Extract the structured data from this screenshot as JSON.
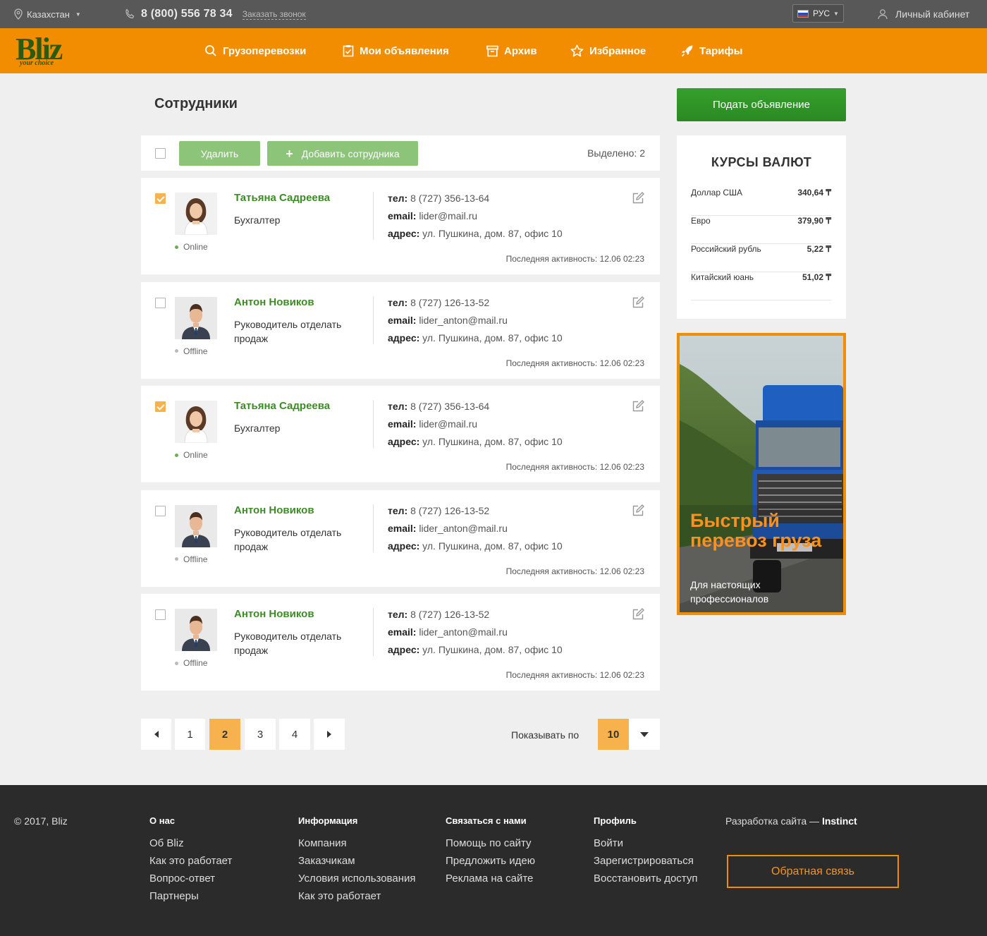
{
  "topbar": {
    "region": "Казахстан",
    "phone": "8 (800) 556 78 34",
    "callback": "Заказать звонок",
    "lang": "РУС",
    "cabinet": "Личный кабинет"
  },
  "logo": {
    "main": "Bliz",
    "sub": "your choice"
  },
  "nav": [
    {
      "label": "Грузоперевозки",
      "icon": "search-icon"
    },
    {
      "label": "Мои объявления",
      "icon": "clipboard-check-icon"
    },
    {
      "label": "Архив",
      "icon": "archive-box-icon"
    },
    {
      "label": "Избранное",
      "icon": "star-icon"
    },
    {
      "label": "Тарифы",
      "icon": "rocket-icon"
    }
  ],
  "page": {
    "title": "Сотрудники"
  },
  "toolbar": {
    "delete": "Удалить",
    "add": "Добавить сотрудника",
    "selected": "Выделено: 2"
  },
  "employees": [
    {
      "name": "Татьяна Садреева",
      "role": "Бухгалтер",
      "status": "Online",
      "checked": true,
      "gender": "female",
      "tel_label": "тел:",
      "tel": "8 (727) 356-13-64",
      "email_label": "email:",
      "email": "lider@mail.ru",
      "addr_label": "адрес:",
      "addr": "ул. Пушкина, дом. 87, офис 10",
      "activity": "Последняя активность: 12.06  02:23"
    },
    {
      "name": "Антон Новиков",
      "role": "Руководитель отделать продаж",
      "status": "Offline",
      "checked": false,
      "gender": "male",
      "tel_label": "тел:",
      "tel": "8 (727) 126-13-52",
      "email_label": "email:",
      "email": "lider_anton@mail.ru",
      "addr_label": "адрес:",
      "addr": "ул. Пушкина, дом. 87, офис 10",
      "activity": "Последняя активность: 12.06  02:23"
    },
    {
      "name": "Татьяна Садреева",
      "role": "Бухгалтер",
      "status": "Online",
      "checked": true,
      "gender": "female",
      "tel_label": "тел:",
      "tel": "8 (727) 356-13-64",
      "email_label": "email:",
      "email": "lider@mail.ru",
      "addr_label": "адрес:",
      "addr": "ул. Пушкина, дом. 87, офис 10",
      "activity": "Последняя активность: 12.06  02:23"
    },
    {
      "name": "Антон Новиков",
      "role": "Руководитель отделать продаж",
      "status": "Offline",
      "checked": false,
      "gender": "male",
      "tel_label": "тел:",
      "tel": "8 (727) 126-13-52",
      "email_label": "email:",
      "email": "lider_anton@mail.ru",
      "addr_label": "адрес:",
      "addr": "ул. Пушкина, дом. 87, офис 10",
      "activity": "Последняя активность: 12.06  02:23"
    },
    {
      "name": "Антон Новиков",
      "role": "Руководитель отделать продаж",
      "status": "Offline",
      "checked": false,
      "gender": "male",
      "tel_label": "тел:",
      "tel": "8 (727) 126-13-52",
      "email_label": "email:",
      "email": "lider_anton@mail.ru",
      "addr_label": "адрес:",
      "addr": "ул. Пушкина, дом. 87, офис 10",
      "activity": "Последняя активность: 12.06  02:23"
    }
  ],
  "pagination": {
    "pages": [
      "1",
      "2",
      "3",
      "4"
    ],
    "current": "2",
    "show_label": "Показывать по",
    "per_page": "10"
  },
  "sidebar": {
    "submit": "Подать объявление",
    "rates_title": "КУРСЫ ВАЛЮТ",
    "rates": [
      {
        "name": "Доллар США",
        "value": "340,64 ₸"
      },
      {
        "name": "Евро",
        "value": "379,90 ₸"
      },
      {
        "name": "Российский рубль",
        "value": "5,22 ₸"
      },
      {
        "name": "Китайский юань",
        "value": "51,02 ₸"
      }
    ],
    "ad_title": "Быстрый перевоз груза",
    "ad_sub": "Для настоящих профессионалов"
  },
  "footer": {
    "copy": "© 2017, Bliz",
    "cols": [
      {
        "head": "О нас",
        "links": [
          "Об Bliz",
          "Как это работает",
          "Вопрос-ответ",
          "Партнеры"
        ]
      },
      {
        "head": "Информация",
        "links": [
          "Компания",
          "Заказчикам",
          "Условия использования",
          "Как это работает"
        ]
      },
      {
        "head": "Связаться с нами",
        "links": [
          "Помощь по сайту",
          "Предложить идею",
          "Реклама на сайте"
        ]
      },
      {
        "head": "Профиль",
        "links": [
          "Войти",
          "Зарегистрироваться",
          "Восстановить доступ"
        ]
      }
    ],
    "dev_prefix": "Разработка сайта — ",
    "dev_name": "Instinct",
    "feedback": "Обратная связь"
  },
  "colors": {
    "orange": "#f28c00",
    "green": "#3c8c25",
    "button_green": "#8cc47a",
    "active_page": "#f7b14d",
    "online": "#6ab04c",
    "offline": "#bbbbbb"
  }
}
